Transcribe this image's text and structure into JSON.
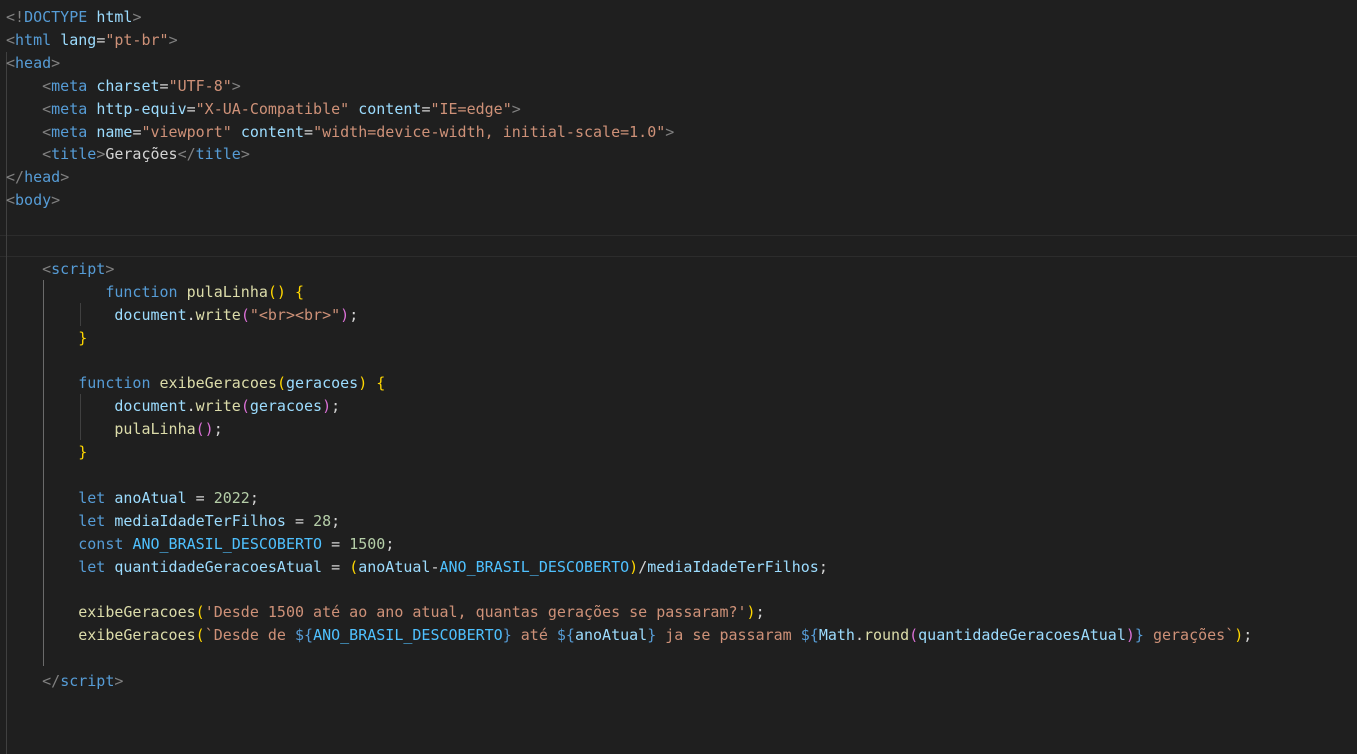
{
  "editor": {
    "colors": {
      "background": "#1f1f1f",
      "tag": "#569cd6",
      "attribute": "#9cdcfe",
      "string": "#ce9178",
      "function": "#dcdcaa",
      "number": "#b5cea8",
      "constant": "#4fc1ff",
      "bracket_gold": "#ffd700",
      "bracket_purple": "#da70d6",
      "bracket_blue": "#179fff"
    },
    "lines": [
      {
        "tokens": [
          [
            "t-punct",
            "&lt;!"
          ],
          [
            "t-doctype",
            "DOCTYPE"
          ],
          [
            "t-text",
            " "
          ],
          [
            "t-attr",
            "html"
          ],
          [
            "t-punct",
            "&gt;"
          ]
        ]
      },
      {
        "tokens": [
          [
            "t-punct",
            "<"
          ],
          [
            "t-tag",
            "html"
          ],
          [
            "t-text",
            " "
          ],
          [
            "t-attr",
            "lang"
          ],
          [
            "t-text",
            "="
          ],
          [
            "t-str",
            "\"pt-br\""
          ],
          [
            "t-punct",
            ">"
          ]
        ]
      },
      {
        "tokens": [
          [
            "t-punct",
            "<"
          ],
          [
            "t-tag",
            "head"
          ],
          [
            "t-punct",
            ">"
          ]
        ]
      },
      {
        "tokens": [
          [
            "t-text",
            "    "
          ],
          [
            "t-punct",
            "<"
          ],
          [
            "t-tag",
            "meta"
          ],
          [
            "t-text",
            " "
          ],
          [
            "t-attr",
            "charset"
          ],
          [
            "t-text",
            "="
          ],
          [
            "t-str",
            "\"UTF-8\""
          ],
          [
            "t-punct",
            ">"
          ]
        ]
      },
      {
        "tokens": [
          [
            "t-text",
            "    "
          ],
          [
            "t-punct",
            "<"
          ],
          [
            "t-tag",
            "meta"
          ],
          [
            "t-text",
            " "
          ],
          [
            "t-attr",
            "http-equiv"
          ],
          [
            "t-text",
            "="
          ],
          [
            "t-str",
            "\"X-UA-Compatible\""
          ],
          [
            "t-text",
            " "
          ],
          [
            "t-attr",
            "content"
          ],
          [
            "t-text",
            "="
          ],
          [
            "t-str",
            "\"IE=edge\""
          ],
          [
            "t-punct",
            ">"
          ]
        ]
      },
      {
        "tokens": [
          [
            "t-text",
            "    "
          ],
          [
            "t-punct",
            "<"
          ],
          [
            "t-tag",
            "meta"
          ],
          [
            "t-text",
            " "
          ],
          [
            "t-attr",
            "name"
          ],
          [
            "t-text",
            "="
          ],
          [
            "t-str",
            "\"viewport\""
          ],
          [
            "t-text",
            " "
          ],
          [
            "t-attr",
            "content"
          ],
          [
            "t-text",
            "="
          ],
          [
            "t-str",
            "\"width=device-width, initial-scale=1.0\""
          ],
          [
            "t-punct",
            ">"
          ]
        ]
      },
      {
        "tokens": [
          [
            "t-text",
            "    "
          ],
          [
            "t-punct",
            "<"
          ],
          [
            "t-tag",
            "title"
          ],
          [
            "t-punct",
            ">"
          ],
          [
            "t-text",
            "Gerações"
          ],
          [
            "t-punct",
            "</"
          ],
          [
            "t-tag",
            "title"
          ],
          [
            "t-punct",
            ">"
          ]
        ]
      },
      {
        "tokens": [
          [
            "t-punct",
            "</"
          ],
          [
            "t-tag",
            "head"
          ],
          [
            "t-punct",
            ">"
          ]
        ]
      },
      {
        "tokens": [
          [
            "t-punct",
            "<"
          ],
          [
            "t-tag",
            "body"
          ],
          [
            "t-punct",
            ">"
          ]
        ]
      },
      {
        "tokens": []
      },
      {
        "tokens": []
      },
      {
        "tokens": [
          [
            "t-text",
            "    "
          ],
          [
            "t-punct",
            "<"
          ],
          [
            "t-tag",
            "script"
          ],
          [
            "t-punct",
            ">"
          ]
        ]
      },
      {
        "tokens": [
          [
            "t-text",
            "           "
          ],
          [
            "t-kw",
            "function"
          ],
          [
            "t-text",
            " "
          ],
          [
            "t-fn",
            "pulaLinha"
          ],
          [
            "t-b1",
            "()"
          ],
          [
            "t-text",
            " "
          ],
          [
            "t-b1",
            "{"
          ]
        ]
      },
      {
        "tokens": [
          [
            "t-text",
            "            "
          ],
          [
            "t-var",
            "document"
          ],
          [
            "t-text",
            "."
          ],
          [
            "t-fn",
            "write"
          ],
          [
            "t-b2",
            "("
          ],
          [
            "t-str",
            "\"<br><br>\""
          ],
          [
            "t-b2",
            ")"
          ],
          [
            "t-text",
            ";"
          ]
        ]
      },
      {
        "tokens": [
          [
            "t-text",
            "        "
          ],
          [
            "t-b1",
            "}"
          ]
        ]
      },
      {
        "tokens": []
      },
      {
        "tokens": [
          [
            "t-text",
            "        "
          ],
          [
            "t-kw",
            "function"
          ],
          [
            "t-text",
            " "
          ],
          [
            "t-fn",
            "exibeGeracoes"
          ],
          [
            "t-b1",
            "("
          ],
          [
            "t-var",
            "geracoes"
          ],
          [
            "t-b1",
            ")"
          ],
          [
            "t-text",
            " "
          ],
          [
            "t-b1",
            "{"
          ]
        ]
      },
      {
        "tokens": [
          [
            "t-text",
            "            "
          ],
          [
            "t-var",
            "document"
          ],
          [
            "t-text",
            "."
          ],
          [
            "t-fn",
            "write"
          ],
          [
            "t-b2",
            "("
          ],
          [
            "t-var",
            "geracoes"
          ],
          [
            "t-b2",
            ")"
          ],
          [
            "t-text",
            ";"
          ]
        ]
      },
      {
        "tokens": [
          [
            "t-text",
            "            "
          ],
          [
            "t-fn",
            "pulaLinha"
          ],
          [
            "t-b2",
            "()"
          ],
          [
            "t-text",
            ";"
          ]
        ]
      },
      {
        "tokens": [
          [
            "t-text",
            "        "
          ],
          [
            "t-b1",
            "}"
          ]
        ]
      },
      {
        "tokens": []
      },
      {
        "tokens": [
          [
            "t-text",
            "        "
          ],
          [
            "t-kw",
            "let"
          ],
          [
            "t-text",
            " "
          ],
          [
            "t-var",
            "anoAtual"
          ],
          [
            "t-text",
            " = "
          ],
          [
            "t-num",
            "2022"
          ],
          [
            "t-text",
            ";"
          ]
        ]
      },
      {
        "tokens": [
          [
            "t-text",
            "        "
          ],
          [
            "t-kw",
            "let"
          ],
          [
            "t-text",
            " "
          ],
          [
            "t-var",
            "mediaIdadeTerFilhos"
          ],
          [
            "t-text",
            " = "
          ],
          [
            "t-num",
            "28"
          ],
          [
            "t-text",
            ";"
          ]
        ]
      },
      {
        "tokens": [
          [
            "t-text",
            "        "
          ],
          [
            "t-kw",
            "const"
          ],
          [
            "t-text",
            " "
          ],
          [
            "t-const",
            "ANO_BRASIL_DESCOBERTO"
          ],
          [
            "t-text",
            " = "
          ],
          [
            "t-num",
            "1500"
          ],
          [
            "t-text",
            ";"
          ]
        ]
      },
      {
        "tokens": [
          [
            "t-text",
            "        "
          ],
          [
            "t-kw",
            "let"
          ],
          [
            "t-text",
            " "
          ],
          [
            "t-var",
            "quantidadeGeracoesAtual"
          ],
          [
            "t-text",
            " = "
          ],
          [
            "t-b1",
            "("
          ],
          [
            "t-var",
            "anoAtual"
          ],
          [
            "t-text",
            "-"
          ],
          [
            "t-const",
            "ANO_BRASIL_DESCOBERTO"
          ],
          [
            "t-b1",
            ")"
          ],
          [
            "t-text",
            "/"
          ],
          [
            "t-var",
            "mediaIdadeTerFilhos"
          ],
          [
            "t-text",
            ";"
          ]
        ]
      },
      {
        "tokens": []
      },
      {
        "tokens": [
          [
            "t-text",
            "        "
          ],
          [
            "t-fn",
            "exibeGeracoes"
          ],
          [
            "t-b1",
            "("
          ],
          [
            "t-str",
            "'Desde 1500 até ao ano atual, quantas gerações se passaram?'"
          ],
          [
            "t-b1",
            ")"
          ],
          [
            "t-text",
            ";"
          ]
        ]
      },
      {
        "tokens": [
          [
            "t-text",
            "        "
          ],
          [
            "t-fn",
            "exibeGeracoes"
          ],
          [
            "t-b1",
            "("
          ],
          [
            "t-str",
            "`Desde de "
          ],
          [
            "t-tpl",
            "${"
          ],
          [
            "t-const",
            "ANO_BRASIL_DESCOBERTO"
          ],
          [
            "t-tpl",
            "}"
          ],
          [
            "t-str",
            " até "
          ],
          [
            "t-tpl",
            "${"
          ],
          [
            "t-var",
            "anoAtual"
          ],
          [
            "t-tpl",
            "}"
          ],
          [
            "t-str",
            " ja se passaram "
          ],
          [
            "t-tpl",
            "${"
          ],
          [
            "t-var",
            "Math"
          ],
          [
            "t-text",
            "."
          ],
          [
            "t-fn",
            "round"
          ],
          [
            "t-b2",
            "("
          ],
          [
            "t-var",
            "quantidadeGeracoesAtual"
          ],
          [
            "t-b2",
            ")"
          ],
          [
            "t-tpl",
            "}"
          ],
          [
            "t-str",
            " gerações`"
          ],
          [
            "t-b1",
            ")"
          ],
          [
            "t-text",
            ";"
          ]
        ]
      },
      {
        "tokens": []
      },
      {
        "tokens": [
          [
            "t-text",
            "    "
          ],
          [
            "t-punct",
            "</"
          ],
          [
            "t-tag",
            "script"
          ],
          [
            "t-punct",
            ">"
          ]
        ]
      }
    ]
  }
}
